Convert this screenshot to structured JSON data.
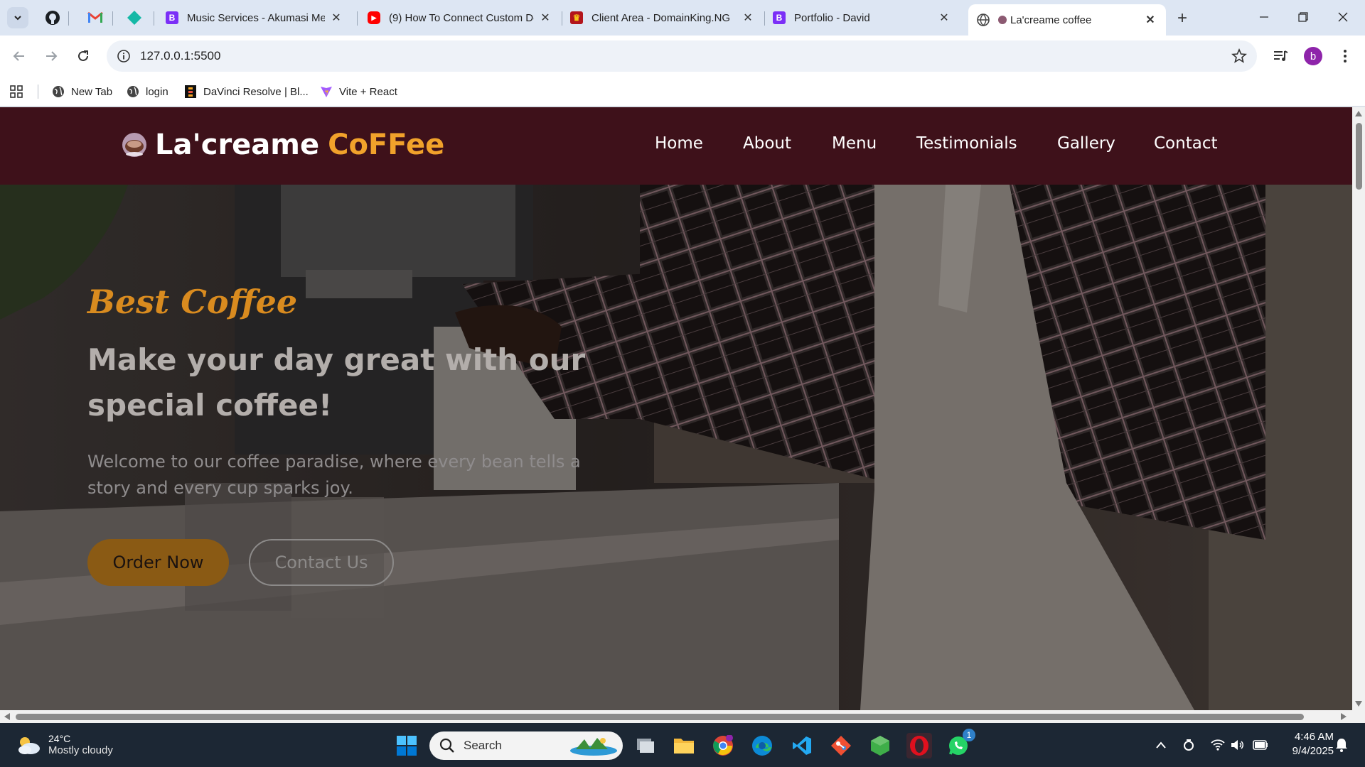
{
  "browser": {
    "tabs": [
      {
        "title": "Music Services - Akumasi Media",
        "fav_letter": "B",
        "fav_color": "#7b2ff7"
      },
      {
        "title": "(9) How To Connect Custom Domain",
        "fav_letter": "▶",
        "fav_color": "#ff0000"
      },
      {
        "title": "Client Area - DomainKing.NG",
        "fav_letter": "♛",
        "fav_color": "#b3151c"
      },
      {
        "title": "Portfolio - David",
        "fav_letter": "B",
        "fav_color": "#7b2ff7"
      }
    ],
    "active_tab": {
      "title": "La'creame coffee"
    },
    "url": "127.0.0.1:5500",
    "profile_initial": "b",
    "bookmarks": [
      {
        "label": "New Tab"
      },
      {
        "label": "login"
      },
      {
        "label": "DaVinci Resolve | Bl..."
      },
      {
        "label": "Vite + React"
      }
    ]
  },
  "site": {
    "brand_part1": "La'creame",
    "brand_part2": "CoFFee",
    "nav": [
      "Home",
      "About",
      "Menu",
      "Testimonials",
      "Gallery",
      "Contact"
    ],
    "hero": {
      "tagline": "Best Coffee",
      "headline": "Make your day great with our special coffee!",
      "subtext": "Welcome to our coffee paradise, where every bean tells a story and every cup sparks joy.",
      "primary_button": "Order Now",
      "secondary_button": "Contact Us"
    },
    "colors": {
      "header_bg": "#3e111a",
      "accent": "#f1a22b"
    }
  },
  "taskbar": {
    "weather_temp": "24°C",
    "weather_desc": "Mostly cloudy",
    "search_placeholder": "Search",
    "whatsapp_badge": "1",
    "time": "4:46 AM",
    "date": "9/4/2025"
  }
}
